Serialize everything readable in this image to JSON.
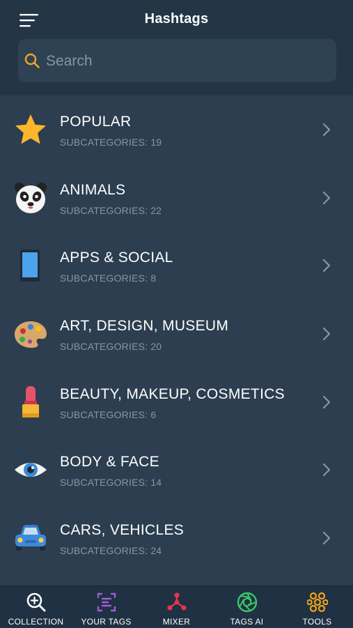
{
  "header": {
    "title": "Hashtags"
  },
  "search": {
    "placeholder": "Search",
    "value": "",
    "icon": "search-icon",
    "icon_color": "#f5a623"
  },
  "categories": [
    {
      "label": "POPULAR",
      "subcategories": "SUBCATEGORIES: 19",
      "icon": "star-icon"
    },
    {
      "label": "ANIMALS",
      "subcategories": "SUBCATEGORIES: 22",
      "icon": "panda-icon"
    },
    {
      "label": "APPS & SOCIAL",
      "subcategories": "SUBCATEGORIES: 8",
      "icon": "phone-icon"
    },
    {
      "label": "ART, DESIGN, MUSEUM",
      "subcategories": "SUBCATEGORIES: 20",
      "icon": "palette-icon"
    },
    {
      "label": "BEAUTY, MAKEUP, COSMETICS",
      "subcategories": "SUBCATEGORIES: 6",
      "icon": "lipstick-icon"
    },
    {
      "label": "BODY & FACE",
      "subcategories": "SUBCATEGORIES: 14",
      "icon": "eye-icon"
    },
    {
      "label": "CARS, VEHICLES",
      "subcategories": "SUBCATEGORIES: 24",
      "icon": "car-icon"
    }
  ],
  "tabbar": {
    "items": [
      {
        "label": "COLLECTION",
        "icon": "magnify-plus-icon",
        "color": "#ffffff"
      },
      {
        "label": "YOUR TAGS",
        "icon": "tag-list-icon",
        "color": "#a05cd6"
      },
      {
        "label": "MIXER",
        "icon": "mixer-icon",
        "color": "#e8344f"
      },
      {
        "label": "TAGS AI",
        "icon": "aperture-icon",
        "color": "#3cc76a"
      },
      {
        "label": "TOOLS",
        "icon": "hexagons-icon",
        "color": "#f2a516"
      }
    ]
  },
  "colors": {
    "background": "#2c3e50",
    "header": "#243646",
    "tabbar": "#1f3142",
    "subtitle": "#8897a5"
  }
}
